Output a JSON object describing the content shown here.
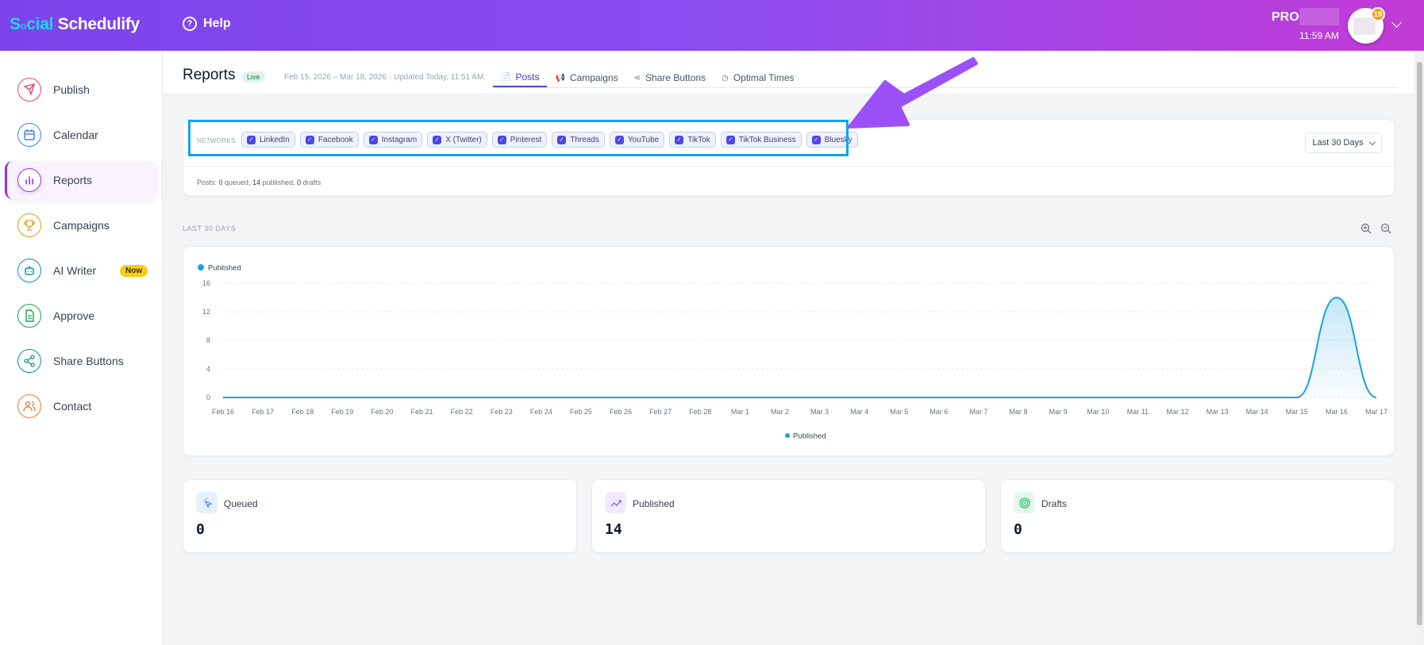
{
  "header": {
    "logo_prefix": "S",
    "logo_o": "o",
    "logo_mid": "cial",
    "logo_rest": " Schedulify",
    "help": "Help",
    "plan": "PRO",
    "time": "11:59 AM",
    "notifications": "19"
  },
  "sidebar": {
    "items": [
      {
        "label": "Publish",
        "icon": "send-icon",
        "color": "#e0457b"
      },
      {
        "label": "Calendar",
        "icon": "calendar-icon",
        "color": "#3b82f6"
      },
      {
        "label": "Reports",
        "icon": "bar-chart-icon",
        "color": "#9333ea",
        "active": true
      },
      {
        "label": "Campaigns",
        "icon": "trophy-icon",
        "color": "#d4a017"
      },
      {
        "label": "AI Writer",
        "icon": "robot-icon",
        "color": "#0891b2",
        "badge": "Now"
      },
      {
        "label": "Approve",
        "icon": "document-icon",
        "color": "#16a34a"
      },
      {
        "label": "Share Buttons",
        "icon": "share-icon",
        "color": "#0d9488"
      },
      {
        "label": "Contact",
        "icon": "users-icon",
        "color": "#ea7a2e"
      }
    ]
  },
  "page": {
    "title": "Reports",
    "status": "Live",
    "date_range": "Feb 15, 2026 – Mar 18, 2026 · Updated Today, 11:51 AM",
    "tabs": [
      {
        "label": "Posts",
        "active": true
      },
      {
        "label": "Campaigns"
      },
      {
        "label": "Share Buttons"
      },
      {
        "label": "Optimal Times"
      }
    ]
  },
  "filters": {
    "networks_label": "NETWORKS",
    "networks": [
      "LinkedIn",
      "Facebook",
      "Instagram",
      "X (Twitter)",
      "Pinterest",
      "Threads",
      "YouTube",
      "TikTok",
      "TikTok Business",
      "Bluesky"
    ],
    "range": "Last 30 Days",
    "summary_prefix": "Posts: ",
    "queued": "0",
    "queued_s": " queued, ",
    "published": "14",
    "published_s": " published, ",
    "drafts": "0",
    "drafts_s": " drafts"
  },
  "chart_section": {
    "label": "LAST 30 DAYS"
  },
  "chart_data": {
    "type": "area",
    "series": [
      {
        "name": "Published",
        "color": "#1ba1e2",
        "values": [
          0,
          0,
          0,
          0,
          0,
          0,
          0,
          0,
          0,
          0,
          0,
          0,
          0,
          0,
          0,
          0,
          0,
          0,
          0,
          0,
          0,
          0,
          0,
          0,
          0,
          0,
          0,
          0,
          14,
          0
        ]
      }
    ],
    "x": [
      "Feb 16",
      "Feb 17",
      "Feb 18",
      "Feb 19",
      "Feb 20",
      "Feb 21",
      "Feb 22",
      "Feb 23",
      "Feb 24",
      "Feb 25",
      "Feb 26",
      "Feb 27",
      "Feb 28",
      "Mar 1",
      "Mar 2",
      "Mar 3",
      "Mar 4",
      "Mar 5",
      "Mar 6",
      "Mar 7",
      "Mar 8",
      "Mar 9",
      "Mar 10",
      "Mar 11",
      "Mar 12",
      "Mar 13",
      "Mar 14",
      "Mar 15",
      "Mar 16",
      "Mar 17"
    ],
    "yticks": [
      "0",
      "4",
      "8",
      "12",
      "16"
    ],
    "ylim": [
      0,
      16
    ],
    "grid": true,
    "legend": "top-left and bottom-center"
  },
  "stats": [
    {
      "label": "Queued",
      "value": "0",
      "icon": "pointer-click-icon",
      "bg": "#e8f0fe",
      "color": "#3b82f6"
    },
    {
      "label": "Published",
      "value": "14",
      "icon": "trending-up-icon",
      "bg": "#f1ebfd",
      "color": "#8b5cf6"
    },
    {
      "label": "Drafts",
      "value": "0",
      "icon": "target-icon",
      "bg": "#e6f8ee",
      "color": "#22c55e"
    }
  ]
}
